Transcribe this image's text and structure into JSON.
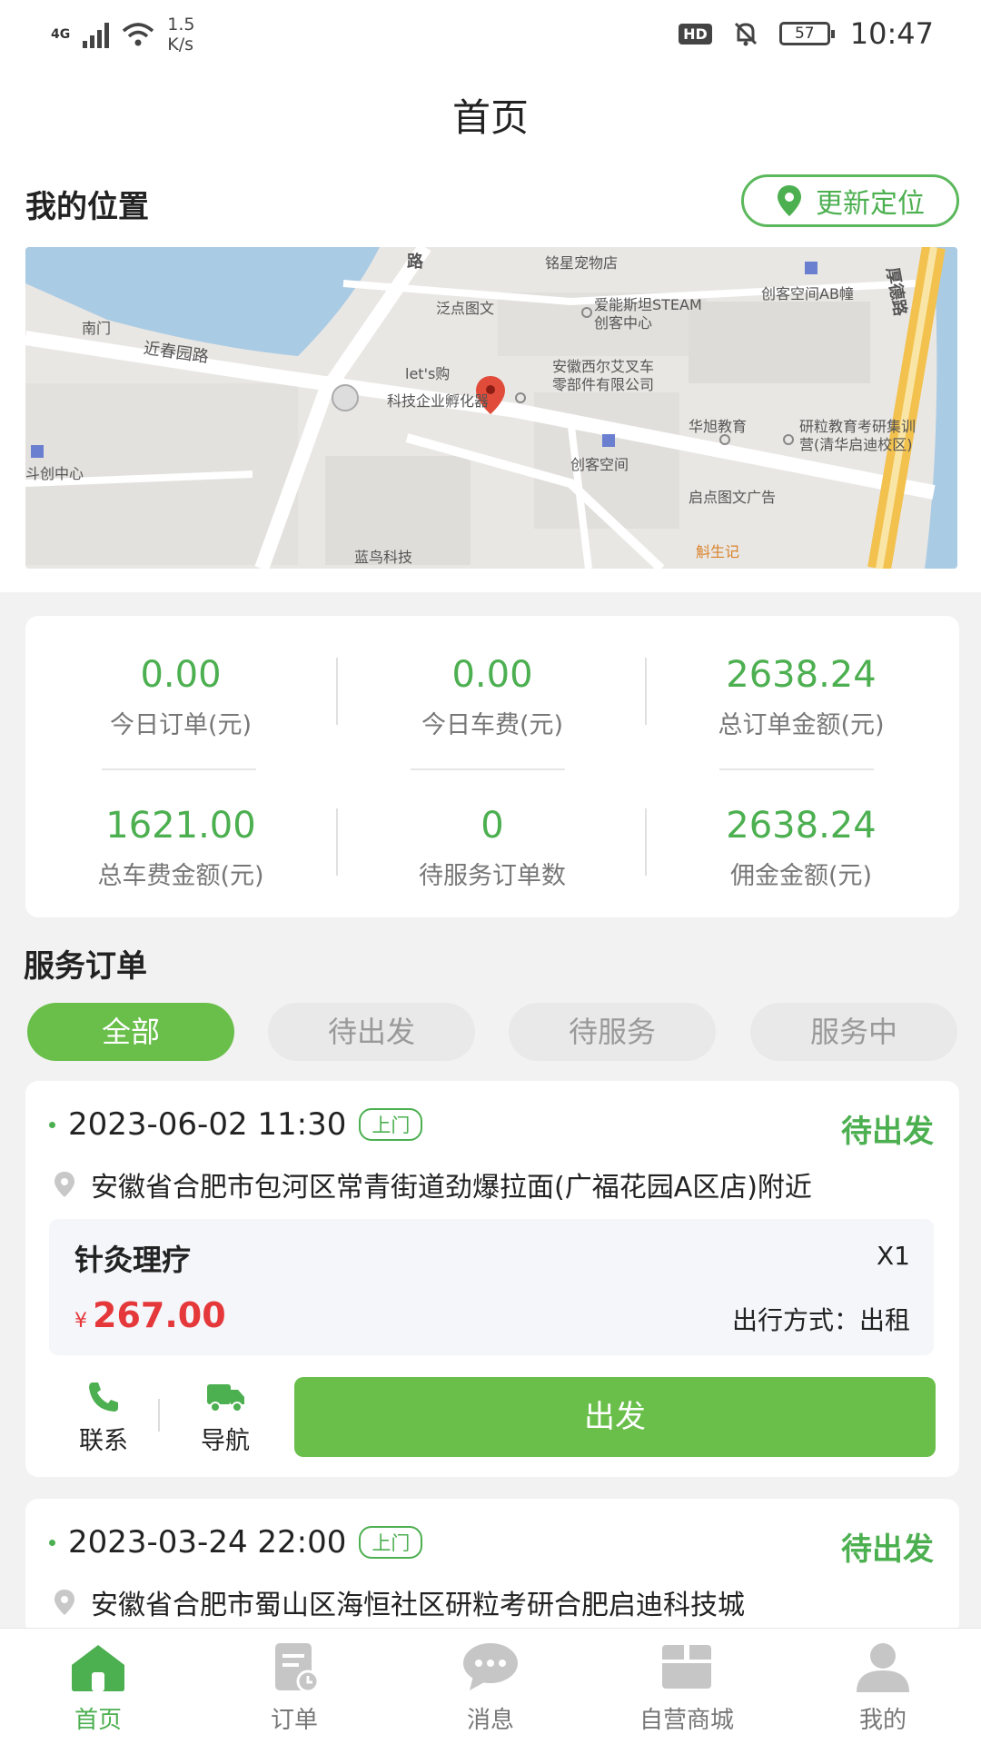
{
  "status_bar": {
    "network": "4G",
    "speed": "1.5",
    "speed_unit": "K/s",
    "hd": "HD",
    "battery": "57",
    "time": "10:47"
  },
  "header": {
    "title": "首页"
  },
  "location": {
    "title": "我的位置",
    "relocate_label": "更新定位",
    "map_labels": {
      "pet_shop": "铭星宠物店",
      "nanmen": "南门",
      "fandian": "泛点图文",
      "steam": "爱能斯坦STEAM",
      "steam2": "创客中心",
      "chuangke_ab": "创客空间AB幢",
      "houde": "厚德路",
      "jinchun": "近春园路",
      "lets": "let's购",
      "anhui_xi": "安徽西尔艾叉车",
      "anhui_xi2": "零部件有限公司",
      "kejiqiye": "科技企业孵化器",
      "huaxu": "华旭教育",
      "yanli": "研粒教育考研集训",
      "yanli2": "营(清华启迪校区)",
      "chuangzhong": "斗创中心",
      "chuangke": "创客空间",
      "qidian": "启点图文广告",
      "lanniao": "蓝鸟科技",
      "xiesheng": "斛生记",
      "lu": "路"
    }
  },
  "stats": [
    {
      "value": "0.00",
      "label": "今日订单(元)"
    },
    {
      "value": "0.00",
      "label": "今日车费(元)"
    },
    {
      "value": "2638.24",
      "label": "总订单金额(元)"
    },
    {
      "value": "1621.00",
      "label": "总车费金额(元)"
    },
    {
      "value": "0",
      "label": "待服务订单数"
    },
    {
      "value": "2638.24",
      "label": "佣金金额(元)"
    }
  ],
  "orders_section": {
    "title": "服务订单",
    "filters": [
      "全部",
      "待出发",
      "待服务",
      "服务中"
    ],
    "active_filter": "全部"
  },
  "orders": [
    {
      "datetime": "2023-06-02 11:30",
      "tag": "上门",
      "status": "待出发",
      "address": "安徽省合肥市包河区常青街道劲爆拉面(广福花园A区店)附近",
      "service_name": "针灸理疗",
      "quantity": "X1",
      "currency": "¥",
      "price": "267.00",
      "travel": "出行方式：出租",
      "contact_label": "联系",
      "navigate_label": "导航",
      "depart_label": "出发"
    },
    {
      "datetime": "2023-03-24 22:00",
      "tag": "上门",
      "status": "待出发",
      "address": "安徽省合肥市蜀山区海恒社区研粒考研合肥启迪科技城"
    }
  ],
  "bottom_nav": [
    {
      "label": "首页",
      "icon": "home-icon",
      "active": true
    },
    {
      "label": "订单",
      "icon": "order-icon",
      "active": false
    },
    {
      "label": "消息",
      "icon": "message-icon",
      "active": false
    },
    {
      "label": "自营商城",
      "icon": "shop-icon",
      "active": false
    },
    {
      "label": "我的",
      "icon": "profile-icon",
      "active": false
    }
  ],
  "colors": {
    "accent": "#4caf50",
    "button": "#6abf4b",
    "price": "#e5383b",
    "inactive": "#999999"
  }
}
